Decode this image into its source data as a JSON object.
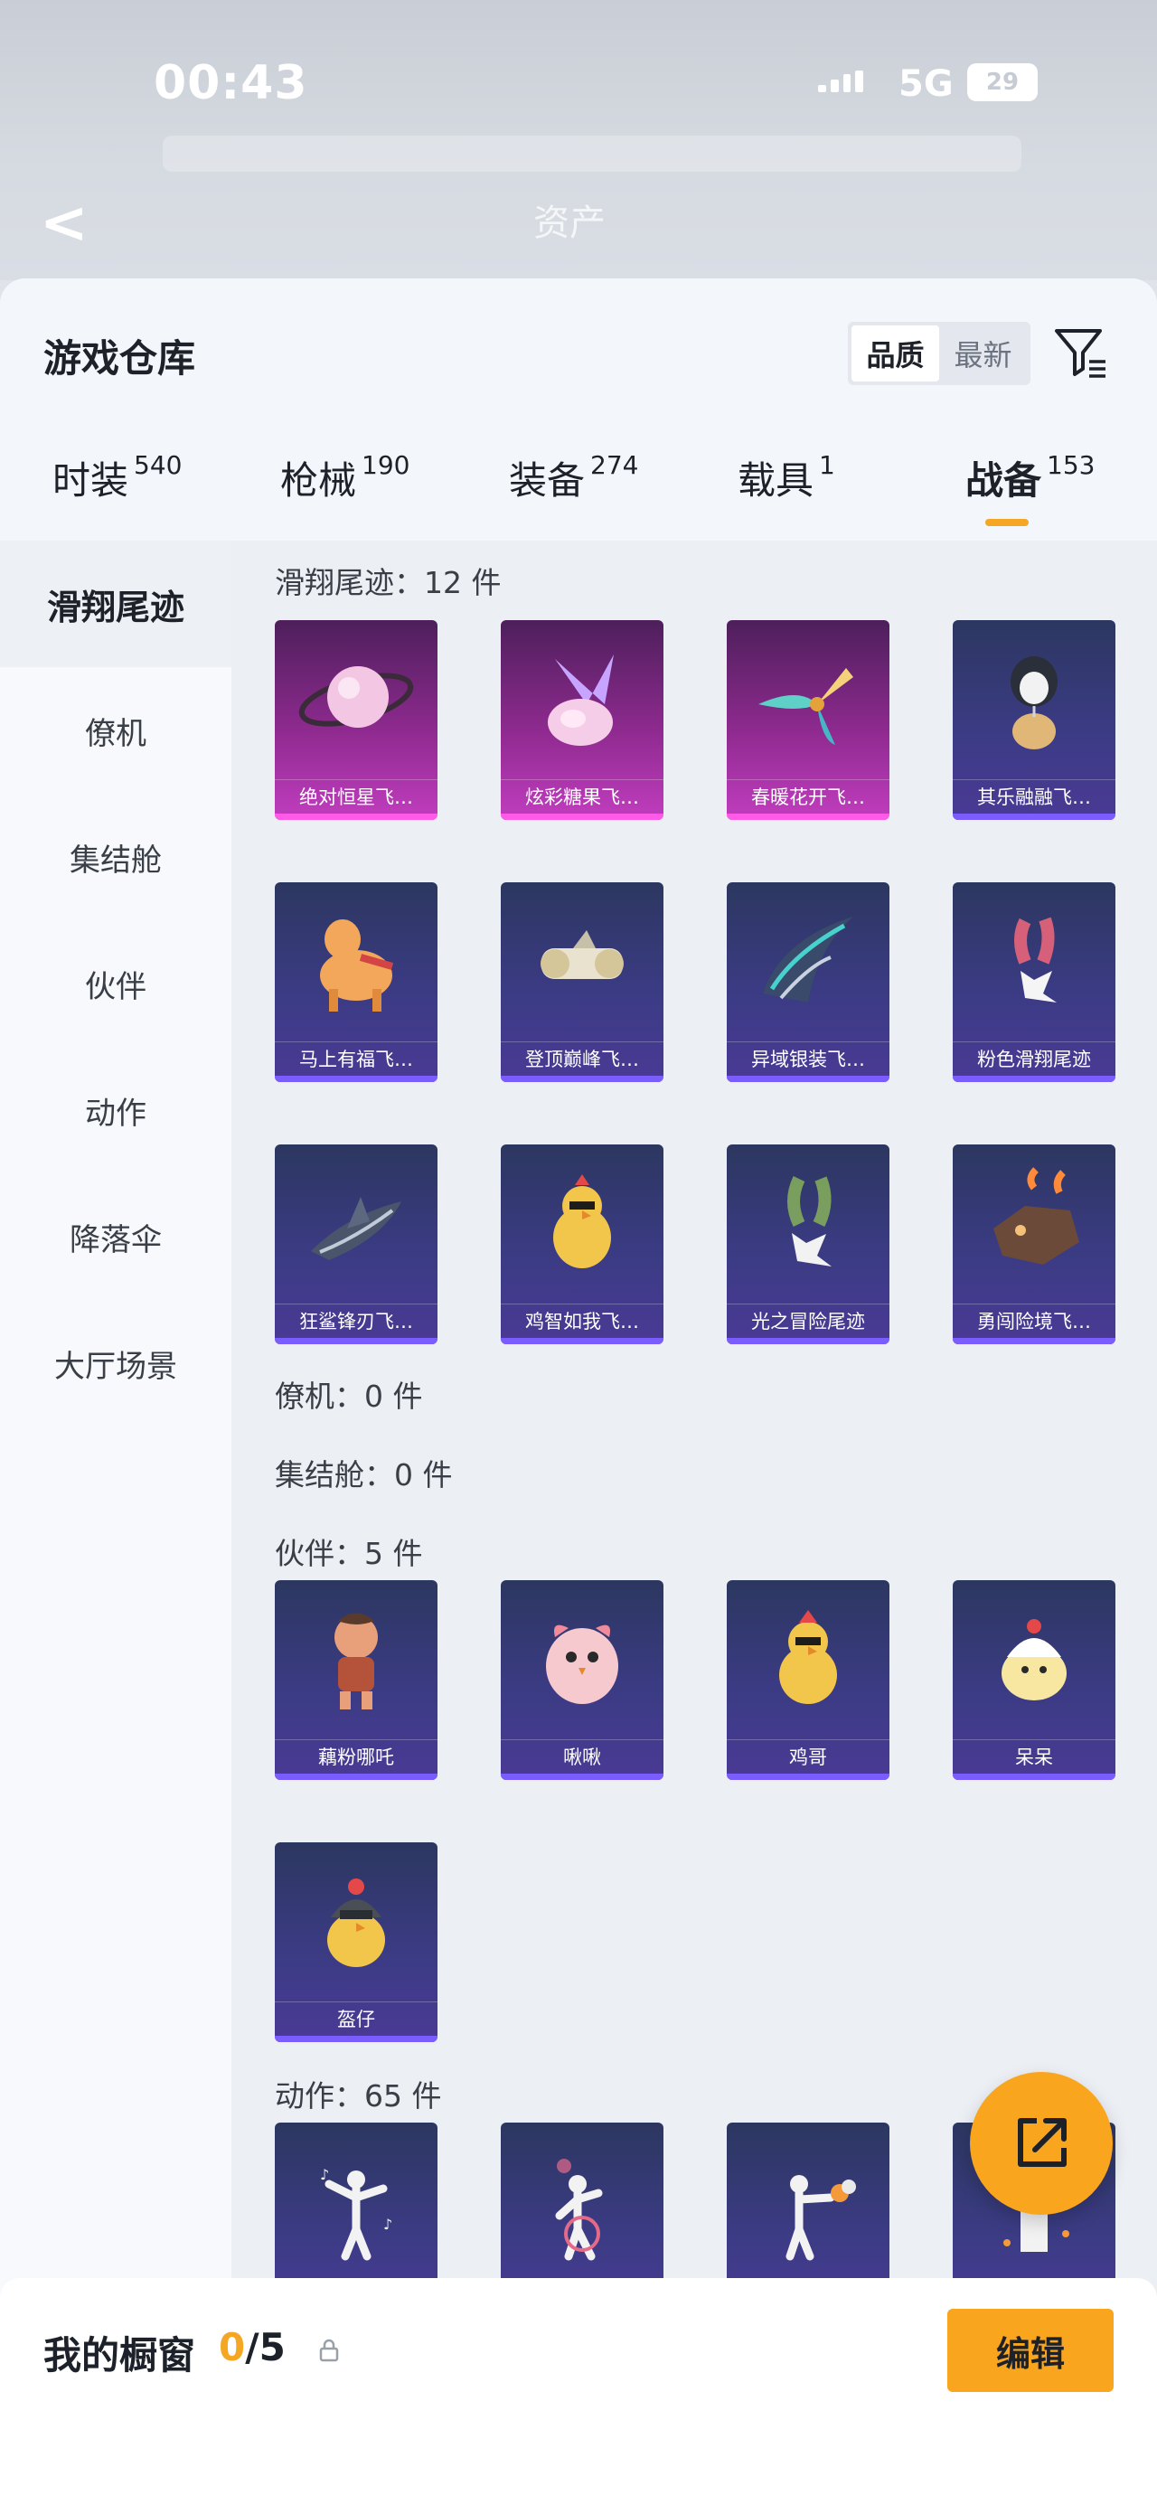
{
  "status": {
    "time": "00:43",
    "network": "5G",
    "battery": "29",
    "nav_title": "资产"
  },
  "header": {
    "title": "游戏仓库",
    "sort_options": [
      "品质",
      "最新"
    ],
    "sort_selected": "品质"
  },
  "tabs": [
    {
      "label": "时装",
      "count": "540"
    },
    {
      "label": "枪械",
      "count": "190"
    },
    {
      "label": "装备",
      "count": "274"
    },
    {
      "label": "载具",
      "count": "1"
    },
    {
      "label": "战备",
      "count": "153",
      "active": true
    }
  ],
  "sidebar": {
    "items": [
      "滑翔尾迹",
      "僚机",
      "集结舱",
      "伙伴",
      "动作",
      "降落伞",
      "大厅场景"
    ],
    "active": "滑翔尾迹"
  },
  "sections": {
    "trail": {
      "title": "滑翔尾迹：12 件",
      "items": [
        "绝对恒星飞…",
        "炫彩糖果飞…",
        "春暖花开飞…",
        "其乐融融飞…",
        "马上有福飞…",
        "登顶巅峰飞…",
        "异域银装飞…",
        "粉色滑翔尾迹",
        "狂鲨锋刃飞…",
        "鸡智如我飞…",
        "光之冒险尾迹",
        "勇闯险境飞…"
      ]
    },
    "wingman": {
      "title": "僚机：0 件"
    },
    "capsule": {
      "title": "集结舱：0 件"
    },
    "partner": {
      "title": "伙伴：5 件",
      "items": [
        "藕粉哪吒",
        "啾啾",
        "鸡哥",
        "呆呆",
        "盔仔"
      ]
    },
    "emote": {
      "title": "动作：65 件"
    }
  },
  "bottom": {
    "label": "我的橱窗",
    "count_current": "0",
    "count_total": "/5",
    "edit_label": "编辑"
  },
  "colors": {
    "accent": "#f9a51d",
    "purple_card": "#3b3b84",
    "pink_card": "#c13dbf"
  }
}
